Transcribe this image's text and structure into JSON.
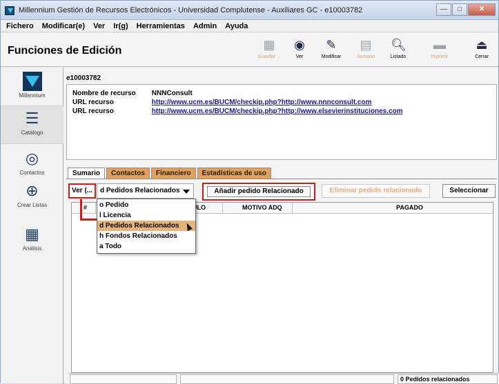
{
  "window": {
    "title": "Millennium Gestión de Recursos Electrónicos - Universidad Complutense - Auxiliares GC - e10003782",
    "btn_min": "—",
    "btn_max": "□",
    "btn_close": "✕"
  },
  "menubar": {
    "items": [
      "Fichero",
      "Modificar(e)",
      "Ver",
      "Ir(g)",
      "Herramientas",
      "Admin",
      "Ayuda"
    ]
  },
  "toolbar": {
    "title": "Funciones de Edición",
    "buttons": [
      {
        "label": "Guardar ...",
        "icon": "save-icon",
        "enabled": false
      },
      {
        "label": "Ver",
        "icon": "view-icon",
        "enabled": true
      },
      {
        "label": "Modificar",
        "icon": "edit-icon",
        "enabled": true
      },
      {
        "label": "Sumario",
        "icon": "summary-icon",
        "enabled": false
      },
      {
        "label": "Listado",
        "icon": "search-icon",
        "enabled": true
      },
      {
        "label": "Imprimir",
        "icon": "printer-icon",
        "enabled": false
      },
      {
        "label": "Cerrar",
        "icon": "close-icon",
        "enabled": true
      }
    ]
  },
  "sidebar": {
    "items": [
      {
        "label": "Millennium",
        "icon": "millennium-logo"
      },
      {
        "label": "Catálogo",
        "icon": "catalog-icon"
      },
      {
        "label": "Contactos",
        "icon": "contacts-icon"
      },
      {
        "label": "Crear Listas",
        "icon": "create-lists-icon"
      },
      {
        "label": "Análisis",
        "icon": "analysis-icon"
      }
    ]
  },
  "record": {
    "id": "e10003782",
    "resource_name_label": "Nombre de recurso",
    "resource_name_value": "NNNConsult",
    "url1_label": "URL recurso",
    "url1_value": "http://www.ucm.es/BUCM/checkip.php?http://www.nnnconsult.com",
    "url2_label": "URL recurso",
    "url2_value": "http://www.ucm.es/BUCM/checkip.php?http://www.elsevierinstituciones.com"
  },
  "tabs": [
    "Sumario",
    "Contactos",
    "Financiero",
    "Estadísticas de uso"
  ],
  "controls": {
    "ver_label": "Ver (...",
    "combo_value": "d Pedidos Relacionados",
    "add_button": "Añadir pedido Relacionado",
    "delete_button": "Eliminar pedido relacionado",
    "select_button": "Seleccionar"
  },
  "dropdown": {
    "options": [
      "o Pedido",
      "l Licencia",
      "d Pedidos Relacionados",
      "h Fondos Relacionados",
      "a Todo"
    ],
    "selected_index": 2
  },
  "grid": {
    "columns": [
      "#",
      "ULO",
      "MOTIVO ADQ",
      "PAGADO"
    ]
  },
  "status": {
    "count_text": "0 Pedidos relacionados"
  }
}
